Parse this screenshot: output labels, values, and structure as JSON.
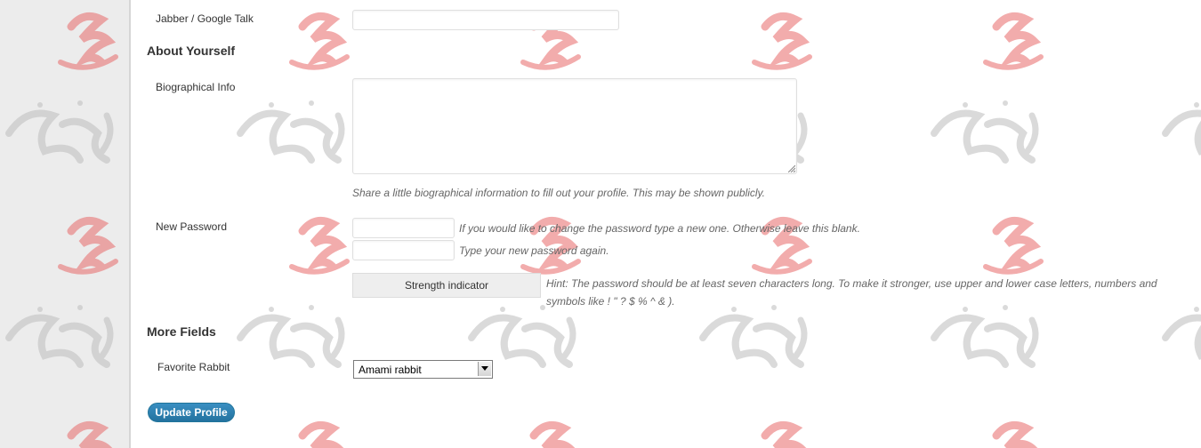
{
  "contact": {
    "jabber_label": "Jabber / Google Talk",
    "jabber_value": ""
  },
  "about": {
    "heading": "About Yourself",
    "bio_label": "Biographical Info",
    "bio_value": "",
    "bio_description": "Share a little biographical information to fill out your profile. This may be shown publicly."
  },
  "password": {
    "label": "New Password",
    "new_hint": "If you would like to change the password type a new one. Otherwise leave this blank.",
    "confirm_hint": "Type your new password again.",
    "strength_label": "Strength indicator",
    "strength_hint_line1": "Hint: The password should be at least seven characters long. To make it stronger, use upper and lower case letters, numbers and",
    "strength_hint_line2": "symbols like ! \" ? $ % ^ & )."
  },
  "more_fields": {
    "heading": "More Fields",
    "rabbit_label": "Favorite Rabbit",
    "rabbit_selected": "Amami rabbit"
  },
  "actions": {
    "update_label": "Update Profile"
  },
  "colors": {
    "button": "#21759b",
    "sidebar": "#ececec",
    "watermark_red": "#e86a6a",
    "watermark_gray": "#bdbdbd"
  }
}
